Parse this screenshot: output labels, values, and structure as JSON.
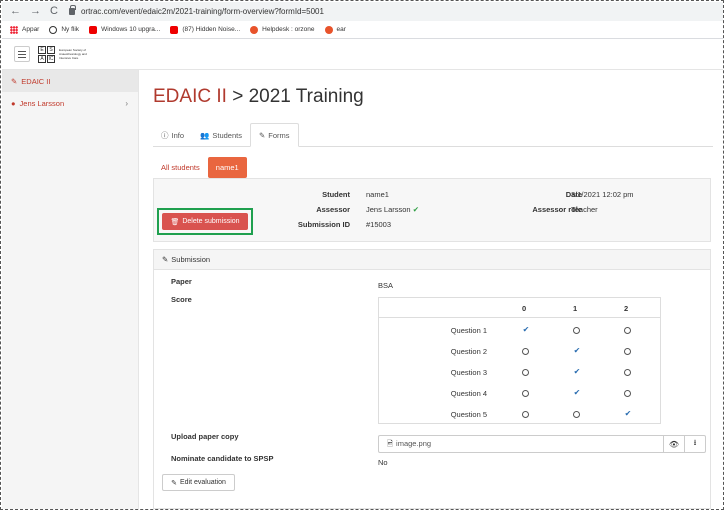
{
  "browser": {
    "back": "←",
    "forward": "→",
    "reload": "C",
    "url": "ortrac.com/event/edaic2m/2021-training/form-overview?formId=5001",
    "bookmarks": [
      {
        "label": "Appar",
        "icon": "apps-icon"
      },
      {
        "label": "Ny flik",
        "icon": "globe-icon"
      },
      {
        "label": "Windows 10 upgra...",
        "icon": "youtube-icon"
      },
      {
        "label": "(87) Hidden Noise...",
        "icon": "youtube-icon"
      },
      {
        "label": "Helpdesk : orzone",
        "icon": "orzone-icon"
      },
      {
        "label": "ear",
        "icon": "orzone-icon"
      }
    ]
  },
  "logo": {
    "letters": [
      "E",
      "S",
      "A",
      "IC"
    ],
    "text": "European Society of Anaesthesiology and Intensive Care"
  },
  "sidebar": {
    "items": [
      {
        "label": "EDAIC II",
        "icon": "edit-icon"
      },
      {
        "label": "Jens Larsson",
        "icon": "user-icon"
      }
    ]
  },
  "page": {
    "title_brand": "EDAIC II",
    "title_sep": ">",
    "title_event": "2021 Training",
    "tabs": [
      "Info",
      "Students",
      "Forms"
    ],
    "pills": [
      "All students",
      "name1"
    ]
  },
  "info": {
    "student_label": "Student",
    "student": "name1",
    "assessor_label": "Assessor",
    "assessor": "Jens Larsson",
    "submission_label": "Submission ID",
    "submission": "#15003",
    "date_label": "Date",
    "date": "3/1/2021 12:02 pm",
    "role_label": "Assessor role",
    "role": "Teacher",
    "delete_label": "Delete submission"
  },
  "submission": {
    "header": "Submission",
    "paper_label": "Paper",
    "paper": "BSA",
    "score_label": "Score",
    "score_columns": [
      "0",
      "1",
      "2"
    ],
    "questions": [
      {
        "label": "Question 1",
        "selected": 0
      },
      {
        "label": "Question 2",
        "selected": 1
      },
      {
        "label": "Question 3",
        "selected": 1
      },
      {
        "label": "Question 4",
        "selected": 1
      },
      {
        "label": "Question 5",
        "selected": 2
      }
    ],
    "upload_label": "Upload paper copy",
    "upload_file": "image.png",
    "nominate_label": "Nominate candidate to SPSP",
    "nominate": "No",
    "edit_label": "Edit evaluation"
  },
  "colors": {
    "brand": "#b03a2e",
    "accent": "#e9663f",
    "danger": "#d9534f",
    "check": "#2a6db0",
    "highlight": "#1fa04f"
  }
}
